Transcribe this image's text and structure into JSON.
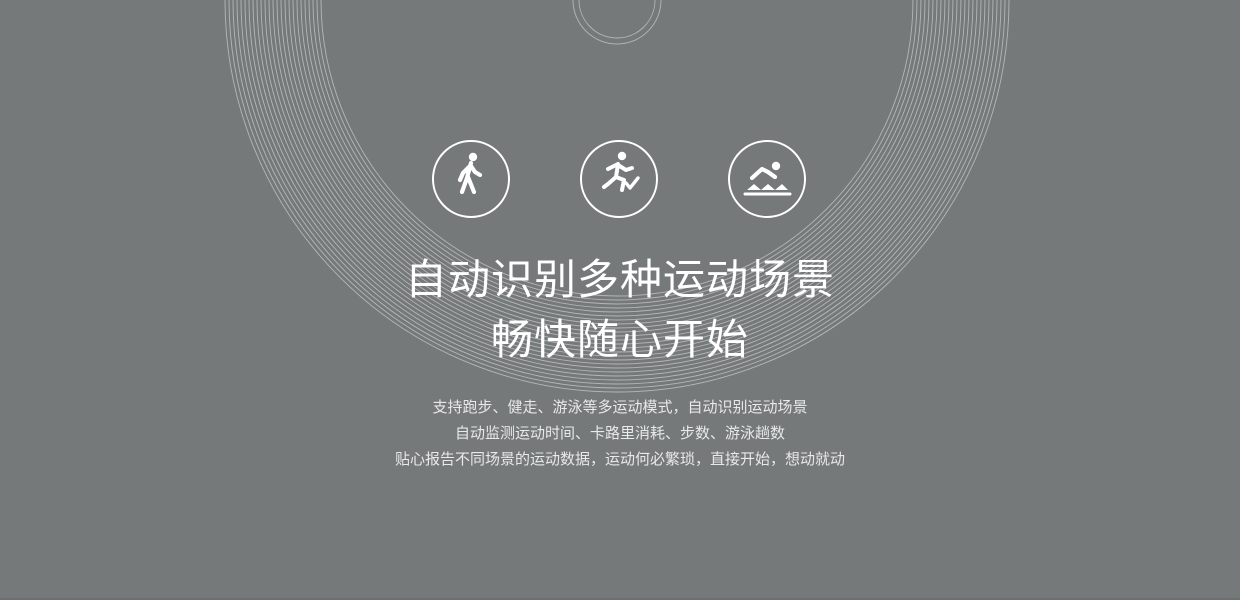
{
  "hero": {
    "headline_line1": "自动识别多种运动场景",
    "headline_line2": "畅快随心开始"
  },
  "description": {
    "line1": "支持跑步、健走、游泳等多运动模式，自动识别运动场景",
    "line2": "自动监测运动时间、卡路里消耗、步数、游泳趟数",
    "line3": "贴心报告不同场景的运动数据，运动何必繁琐，直接开始，想动就动"
  },
  "icons": [
    {
      "name": "walking-icon"
    },
    {
      "name": "running-icon"
    },
    {
      "name": "swimming-icon"
    }
  ],
  "colors": {
    "background": "#757979",
    "foreground": "#ffffff",
    "rings": "#c9cccc"
  }
}
